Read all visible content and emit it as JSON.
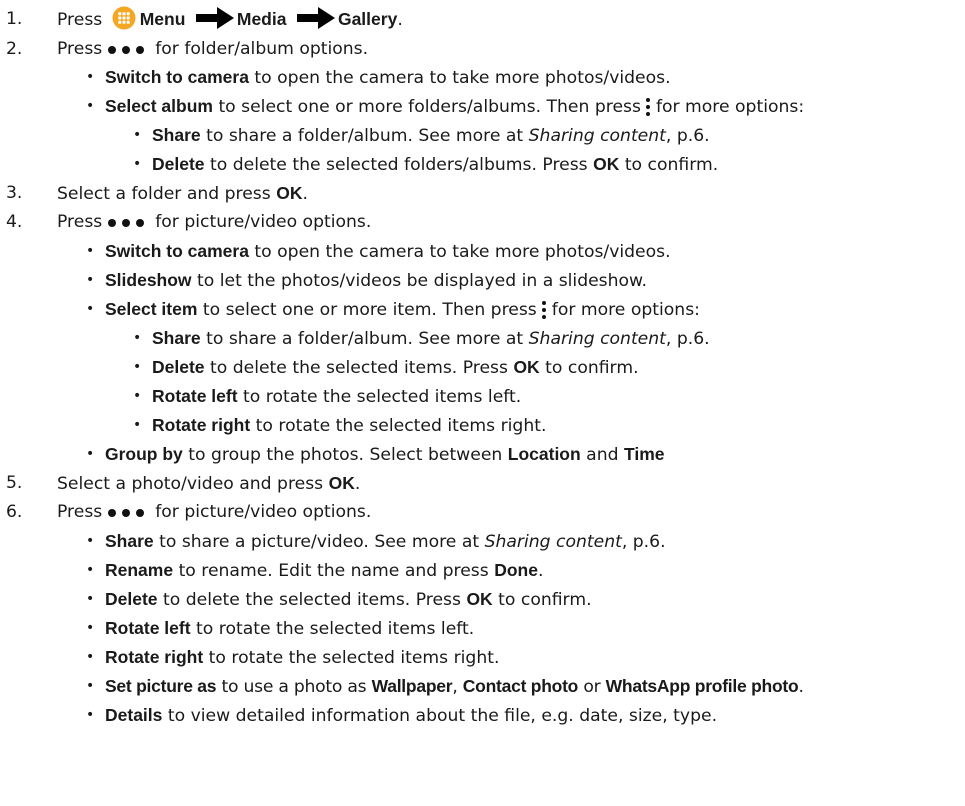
{
  "steps": [
    {
      "num": "1.",
      "press": "Press",
      "menu": "Menu",
      "media": "Media",
      "gallery": "Gallery",
      "end": "."
    },
    {
      "num": "2.",
      "pre": "Press",
      "post": "for folder/album options."
    },
    {
      "num": "3.",
      "pre": "Select a folder and press",
      "key": "OK",
      "post": "."
    },
    {
      "num": "4.",
      "pre": "Press",
      "post": "for picture/video options."
    },
    {
      "num": "5.",
      "pre": "Select a photo/video and press",
      "key": "OK",
      "post": "."
    },
    {
      "num": "6.",
      "pre": "Press",
      "post": "for picture/video options."
    }
  ],
  "step2_items": {
    "switch_camera": {
      "label": "Switch to camera",
      "text": "to open the camera to take more photos/videos."
    },
    "select_album": {
      "label": "Select album",
      "text": "to select one or more folders/albums. Then press",
      "after": "for more options:"
    },
    "share": {
      "label": "Share",
      "text": "to share a folder/album. See more at",
      "ref": "Sharing content",
      "tail": ", p.6."
    },
    "delete": {
      "label": "Delete",
      "text": "to delete the selected folders/albums. Press",
      "key": "OK",
      "tail": "to confirm."
    }
  },
  "step4_items": {
    "switch_camera": {
      "label": "Switch to camera",
      "text": "to open the camera to take more photos/videos."
    },
    "slideshow": {
      "label": "Slideshow",
      "text": "to let the photos/videos be displayed in a slideshow."
    },
    "select_item": {
      "label": "Select item",
      "text": "to select one or more item. Then press",
      "after": "for more options:"
    },
    "share": {
      "label": "Share",
      "text": "to share a folder/album. See more at",
      "ref": "Sharing content",
      "tail": ", p.6."
    },
    "delete": {
      "label": "Delete",
      "text": "to delete the selected items. Press",
      "key": "OK",
      "tail": "to confirm."
    },
    "rotate_left": {
      "label": "Rotate left",
      "text": "to rotate the selected items left."
    },
    "rotate_right": {
      "label": "Rotate right",
      "text": "to rotate the selected items right."
    },
    "group_by": {
      "label": "Group by",
      "text": "to group the photos. Select between",
      "opt1": "Location",
      "and": "and",
      "opt2": "Time"
    }
  },
  "step6_items": {
    "share": {
      "label": "Share",
      "text": "to share a picture/video. See more at",
      "ref": "Sharing content",
      "tail": ", p.6."
    },
    "rename": {
      "label": "Rename",
      "text": "to rename. Edit the name and press",
      "key": "Done",
      "tail": "."
    },
    "delete": {
      "label": "Delete",
      "text": "to delete the selected items. Press",
      "key": "OK",
      "tail": "to confirm."
    },
    "rotate_left": {
      "label": "Rotate left",
      "text": "to rotate the selected items left."
    },
    "rotate_right": {
      "label": "Rotate right",
      "text": "to rotate the selected items right."
    },
    "set_picture": {
      "label": "Set picture as",
      "text": "to use a photo as",
      "opt1": "Wallpaper",
      "sep1": ",",
      "opt2": "Contact photo",
      "or": "or",
      "opt3": "WhatsApp profile photo",
      "tail": "."
    },
    "details": {
      "label": "Details",
      "text": "to view detailed information about the file, e.g. date, size, type."
    }
  },
  "bullet_glyph": "•",
  "icons": {
    "menu": "menu-grid-icon",
    "arrow": "arrow-right-icon",
    "more_h": "more-horizontal-icon",
    "more_v": "more-vertical-icon"
  },
  "colors": {
    "menu_icon": "#f5a623",
    "text": "#1a1a1a"
  }
}
